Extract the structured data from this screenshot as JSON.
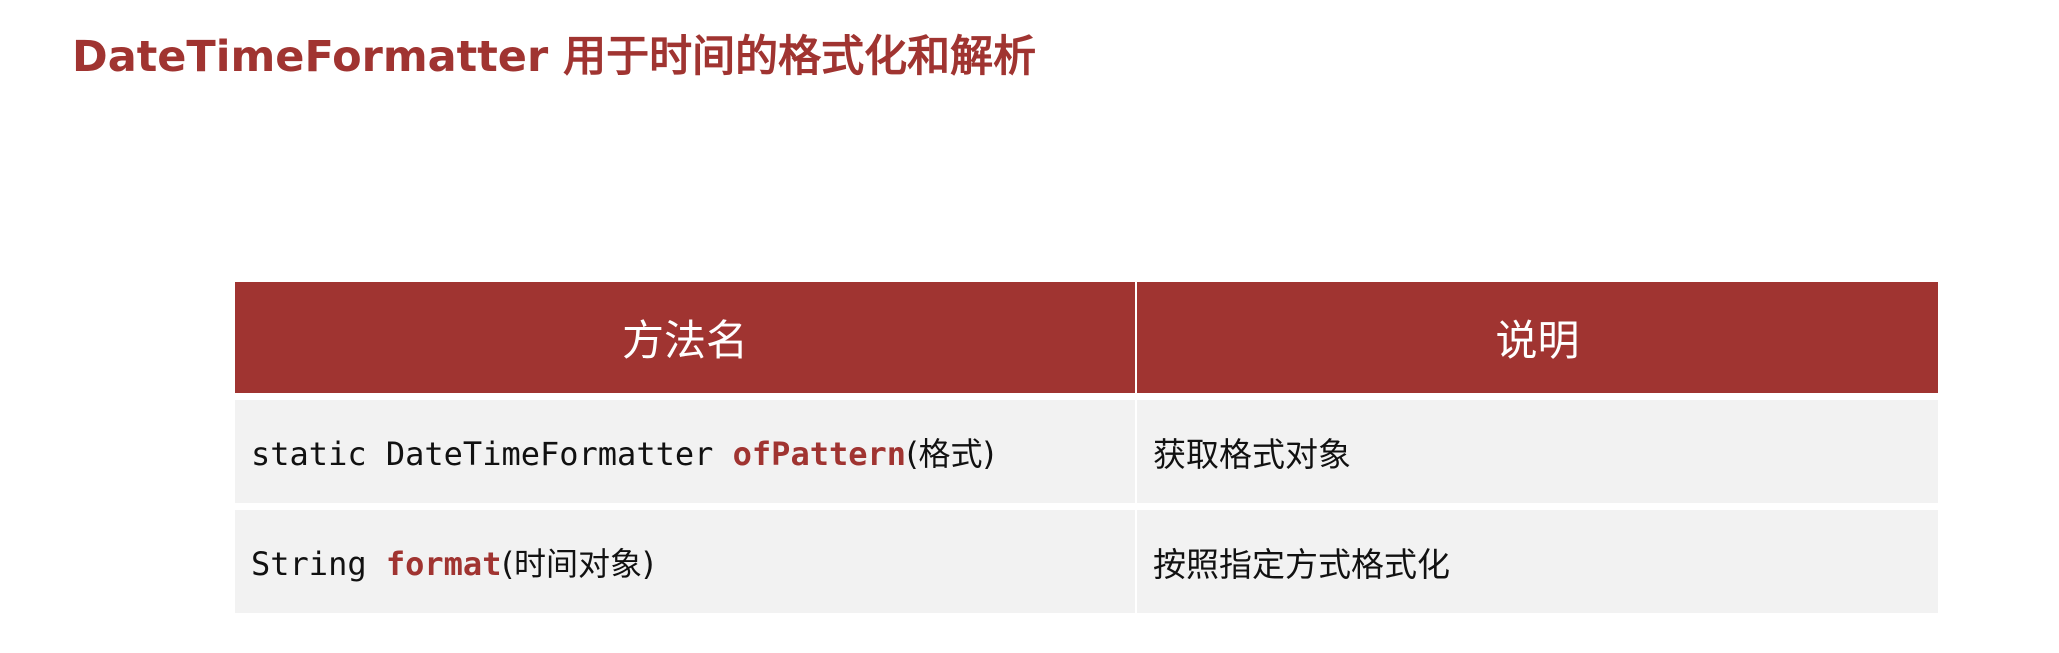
{
  "slide": {
    "title": "DateTimeFormatter 用于时间的格式化和解析"
  },
  "table": {
    "headers": {
      "method_name": "方法名",
      "description": "说明"
    },
    "rows": [
      {
        "prefix": "static DateTimeFormatter ",
        "method": "ofPattern",
        "args": "(格式)",
        "description": "获取格式对象"
      },
      {
        "prefix": "String ",
        "method": "format",
        "args": "(时间对象)",
        "description": "按照指定方式格式化"
      }
    ]
  },
  "colors": {
    "accent": "#a03431",
    "row_background": "#f2f2f2",
    "header_text": "#ffffff"
  }
}
